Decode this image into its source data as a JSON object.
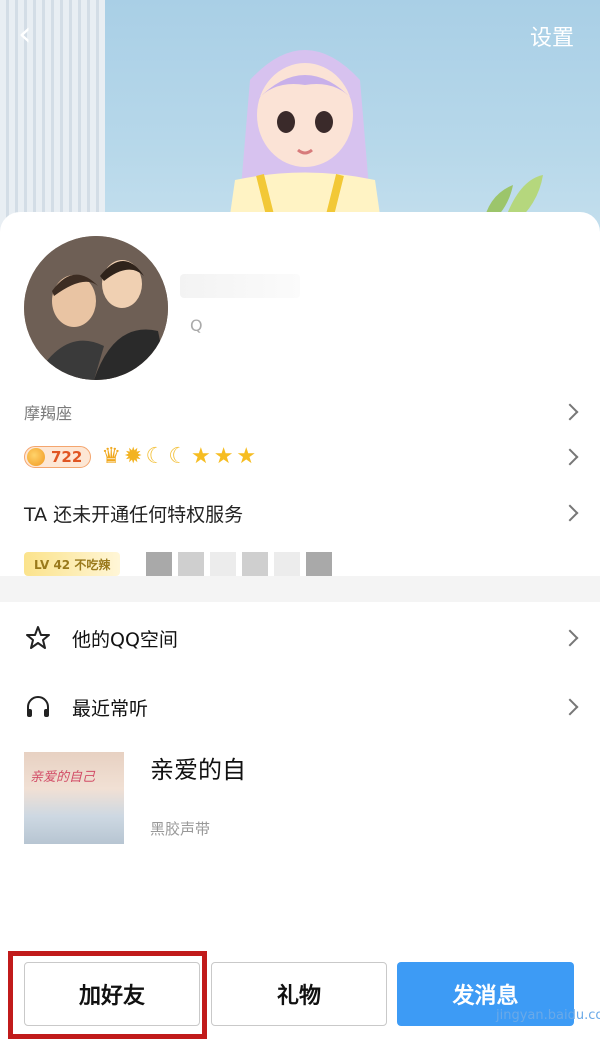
{
  "header": {
    "back_icon": "back-icon",
    "settings_label": "设置"
  },
  "profile": {
    "qq_label": "Q",
    "zodiac": "摩羯座",
    "level": "722",
    "level_icons": [
      "crown-icon",
      "sun-icon",
      "moon-icon",
      "moon-icon",
      "star-icon",
      "star-icon",
      "star-icon"
    ],
    "privilege_text": "TA 还未开通任何特权服务",
    "lv_tag": "LV 42 不吃辣"
  },
  "menu": {
    "qzone_label": "他的QQ空间",
    "recent_label": "最近常听"
  },
  "song": {
    "cover_text": "亲爱的自己",
    "title": "亲爱的自",
    "subtitle": "黑胶声带"
  },
  "actions": {
    "add_friend_label": "加好友",
    "gift_label": "礼物",
    "message_label": "发消息"
  },
  "watermark": "jingyan.baidu.com",
  "colors": {
    "accent_blue": "#3d9bf5",
    "highlight_red": "#c11b1b",
    "level_orange": "#e05522"
  }
}
